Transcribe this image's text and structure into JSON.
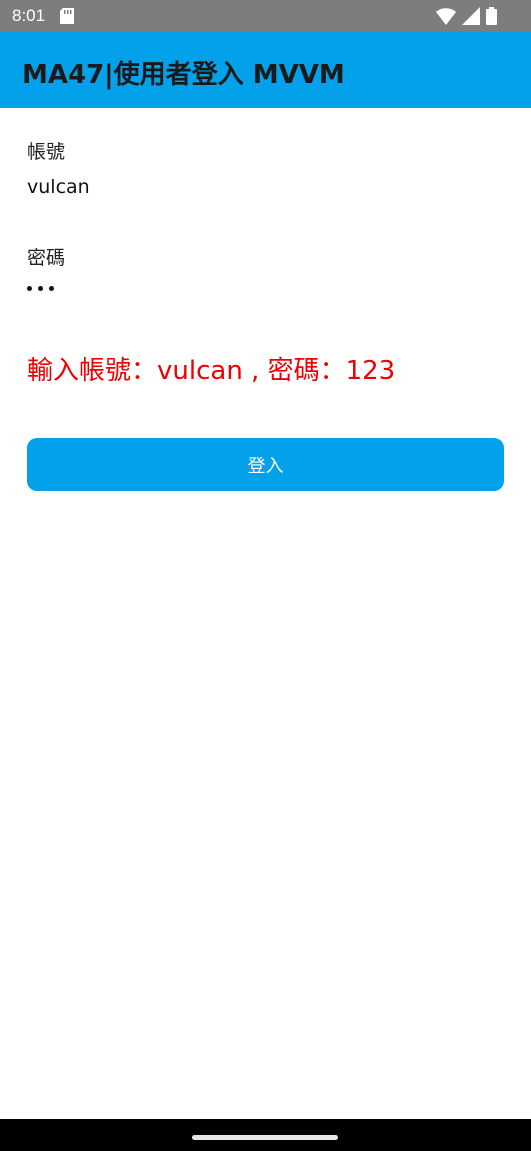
{
  "status_bar": {
    "time": "8:01",
    "icons": [
      "sd-card-icon",
      "wifi-icon",
      "cell-signal-icon",
      "battery-icon"
    ]
  },
  "app_bar": {
    "title": "MA47|使用者登入 MVVM",
    "color": "#03a1ea"
  },
  "form": {
    "account_label": "帳號",
    "account_value": "vulcan",
    "password_label": "密碼",
    "password_masked": "•••",
    "result_message": "輸入帳號：vulcan , 密碼：123",
    "result_color": "#ee0000",
    "login_button_label": "登入"
  }
}
